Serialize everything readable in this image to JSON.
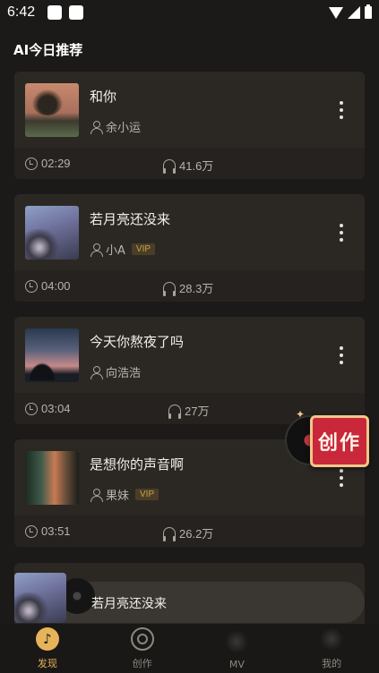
{
  "status_bar": {
    "time": "6:42"
  },
  "section_title": "AI今日推荐",
  "songs": [
    {
      "title": "和你",
      "artist": "余小运",
      "vip": "",
      "duration": "02:29",
      "plays": "41.6万"
    },
    {
      "title": "若月亮还没来",
      "artist": "小A",
      "vip": "VIP",
      "duration": "04:00",
      "plays": "28.3万"
    },
    {
      "title": "今天你熬夜了吗",
      "artist": "向浩浩",
      "vip": "",
      "duration": "03:04",
      "plays": "27万"
    },
    {
      "title": "是想你的声音啊",
      "artist": "果妹",
      "vip": "VIP",
      "duration": "03:51",
      "plays": "26.2万"
    }
  ],
  "create_button": {
    "label": "创作"
  },
  "now_playing": {
    "title": "若月亮还没来"
  },
  "bottom_nav": [
    {
      "label": "发现",
      "icon": "music-note-icon",
      "active": true
    },
    {
      "label": "创作",
      "icon": "create-disc-icon",
      "active": false
    },
    {
      "label": "MV",
      "icon": "mv-icon",
      "active": false
    },
    {
      "label": "我的",
      "icon": "profile-icon",
      "active": false
    }
  ],
  "colors": {
    "accent": "#e6b35a",
    "card_bg": "#2b2824",
    "vip_text": "#c9a24a",
    "create_red": "#c8283a"
  }
}
